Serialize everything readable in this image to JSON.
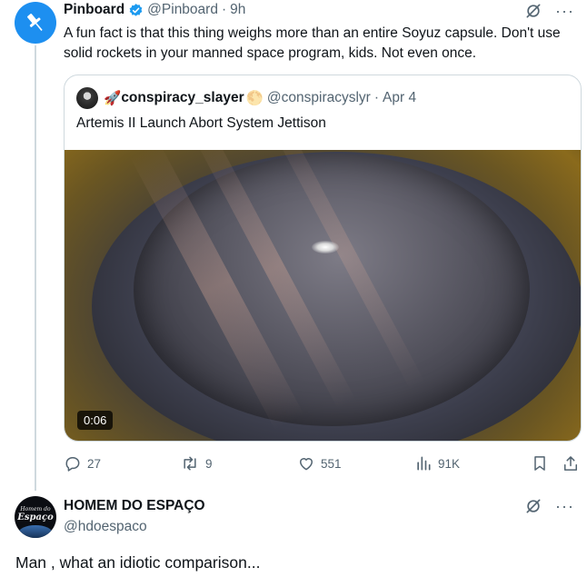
{
  "tweet": {
    "author_name": "Pinboard",
    "author_handle": "@Pinboard",
    "separator": "·",
    "time": "9h",
    "text": "A fun fact is that this thing weighs more than an entire Soyuz capsule. Don't use solid rockets in your manned space program, kids. Not even once.",
    "more_label": "···"
  },
  "quote": {
    "author_emoji": "🚀",
    "author_name": "conspiracy_slayer",
    "badge_emoji": "🌕",
    "author_handle": "@conspiracyslyr",
    "separator": "·",
    "date": "Apr 4",
    "text": "Artemis II Launch Abort System Jettison",
    "video_duration": "0:06"
  },
  "actions": {
    "replies": "27",
    "reposts": "9",
    "likes": "551",
    "views": "91K"
  },
  "reply": {
    "author_name": "HOMEM DO ESPAÇO",
    "author_handle": "@hdoespaco",
    "avatar_text_small": "Homem do",
    "avatar_text_big": "Espaço",
    "text": "Man , what an idiotic comparison...",
    "more_label": "···"
  },
  "colors": {
    "verified": "#1d9bf0",
    "secondary_text": "#536471",
    "border": "#cfd9de"
  },
  "icons": [
    "pushpin-icon",
    "verified-badge-icon",
    "grok-icon",
    "more-icon",
    "reply-icon",
    "repost-icon",
    "like-icon",
    "views-icon",
    "bookmark-icon",
    "share-icon"
  ]
}
